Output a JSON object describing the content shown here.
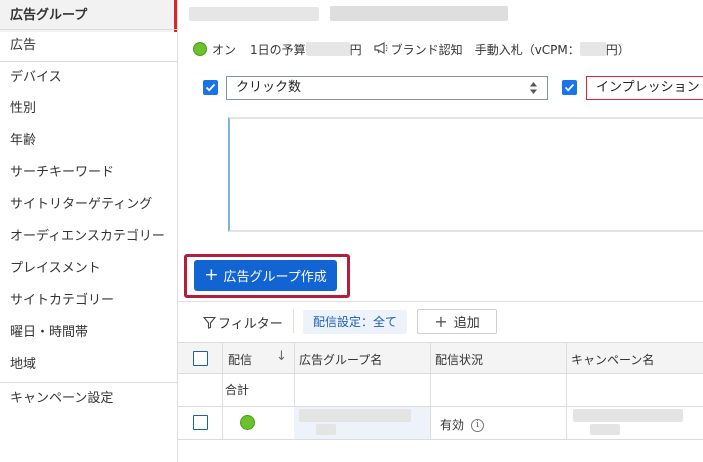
{
  "sidebar": {
    "items": [
      {
        "label": "広告グループ"
      },
      {
        "label": "広告"
      },
      {
        "label": "デバイス"
      },
      {
        "label": "性別"
      },
      {
        "label": "年齢"
      },
      {
        "label": "サーチキーワード"
      },
      {
        "label": "サイトリターゲティング"
      },
      {
        "label": "オーディエンスカテゴリー"
      },
      {
        "label": "プレイスメント"
      },
      {
        "label": "サイトカテゴリー"
      },
      {
        "label": "曜日・時間帯"
      },
      {
        "label": "地域"
      },
      {
        "label": "キャンペーン設定"
      }
    ],
    "active_index": 0
  },
  "status": {
    "state": "オン",
    "budget_label": "1日の予算",
    "budget_unit": "円",
    "objective": "ブランド認知",
    "bidding": "手動入札（vCPM：",
    "bidding_unit": "円）"
  },
  "metrics": {
    "metric1": "クリック数",
    "metric2": "インプレッション"
  },
  "create_button": {
    "label": "広告グループ作成"
  },
  "toolbar": {
    "filter_label": "フィルター",
    "delivery_chip": "配信設定：全て",
    "add_label": "追加"
  },
  "table": {
    "headers": [
      "配信",
      "広告グループ名",
      "配信状況",
      "キャンペーン名"
    ],
    "total_label": "合計",
    "rows": [
      {
        "status": "有効"
      }
    ]
  },
  "colors": {
    "primary": "#1264d2",
    "active_accent": "#d7262c",
    "status_on": "#6cc12c",
    "highlight": "#b71c3c"
  }
}
